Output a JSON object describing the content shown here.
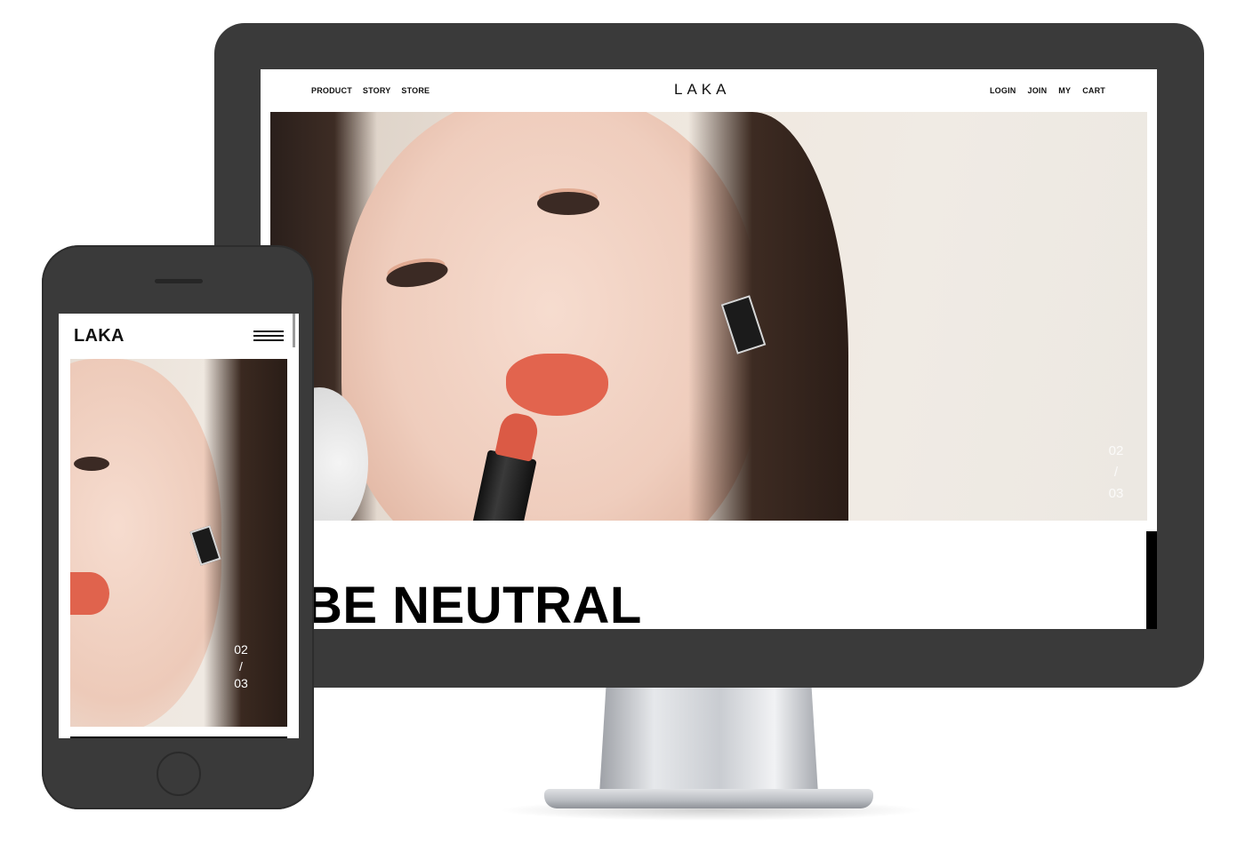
{
  "desktop": {
    "brand": "LAKA",
    "nav_left": [
      "PRODUCT",
      "STORY",
      "STORE"
    ],
    "nav_right": [
      "LOGIN",
      "JOIN",
      "MY",
      "CART"
    ],
    "slide": {
      "current": "02",
      "separator": "/",
      "total": "03"
    },
    "headline": "BE NEUTRAL"
  },
  "mobile": {
    "brand": "LAKA",
    "slide": {
      "current": "02",
      "separator": "/",
      "total": "03"
    }
  },
  "colors": {
    "device_frame": "#3a3a3a",
    "lip_accent": "#e2644e",
    "text": "#111111"
  },
  "icons": {
    "hamburger": "hamburger-menu-icon"
  }
}
